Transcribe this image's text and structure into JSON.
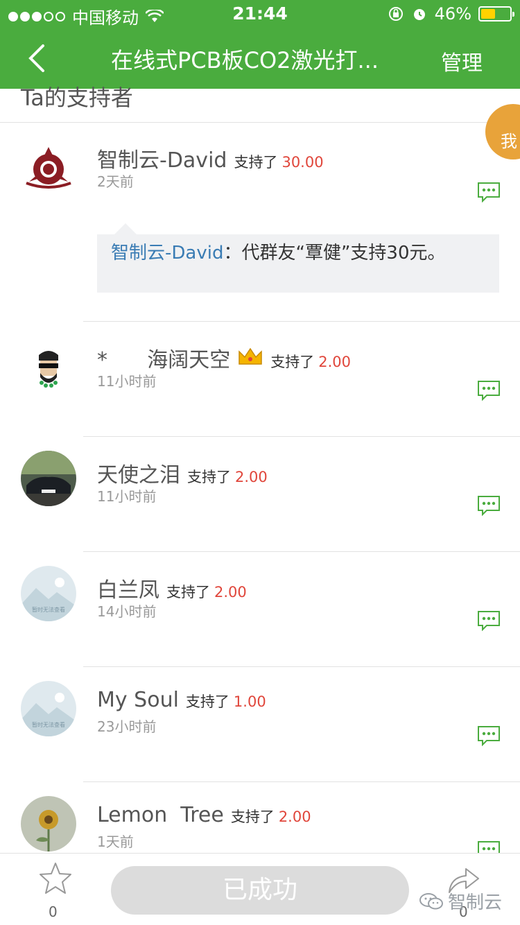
{
  "status_bar": {
    "carrier": "中国移动",
    "time": "21:44",
    "battery": "46%"
  },
  "nav": {
    "title": "在线式PCB板CO2激光打...",
    "manage": "管理"
  },
  "section": {
    "header": "Ta的支持者"
  },
  "me_badge": "我",
  "supporters": [
    {
      "name": "智制云-David",
      "support_label": "支持了",
      "amount": "30.00",
      "time": "2天前"
    },
    {
      "name": "*      海阔天空",
      "support_label": "支持了",
      "amount": "2.00",
      "time": "11小时前"
    },
    {
      "name": "天使之泪",
      "support_label": "支持了",
      "amount": "2.00",
      "time": "11小时前"
    },
    {
      "name": "白兰凤",
      "support_label": "支持了",
      "amount": "2.00",
      "time": "14小时前"
    },
    {
      "name": "My Soul",
      "support_label": "支持了",
      "amount": "1.00",
      "time": "23小时前"
    },
    {
      "name": "Lemon  Tree",
      "support_label": "支持了",
      "amount": "2.00",
      "time": "1天前"
    }
  ],
  "reply": {
    "author": "智制云-David",
    "separator": "：",
    "text": "代群友“覃健”支持30元。"
  },
  "placeholder_avatar_text": "暂时无法查看",
  "bottom": {
    "fav_count": "0",
    "status_button": "已成功",
    "share_count": "0",
    "watermark": "智制云"
  },
  "colors": {
    "brand": "#4aac3e",
    "amount": "#e0463b",
    "badge": "#e8a33a",
    "link": "#3a7cb4"
  }
}
